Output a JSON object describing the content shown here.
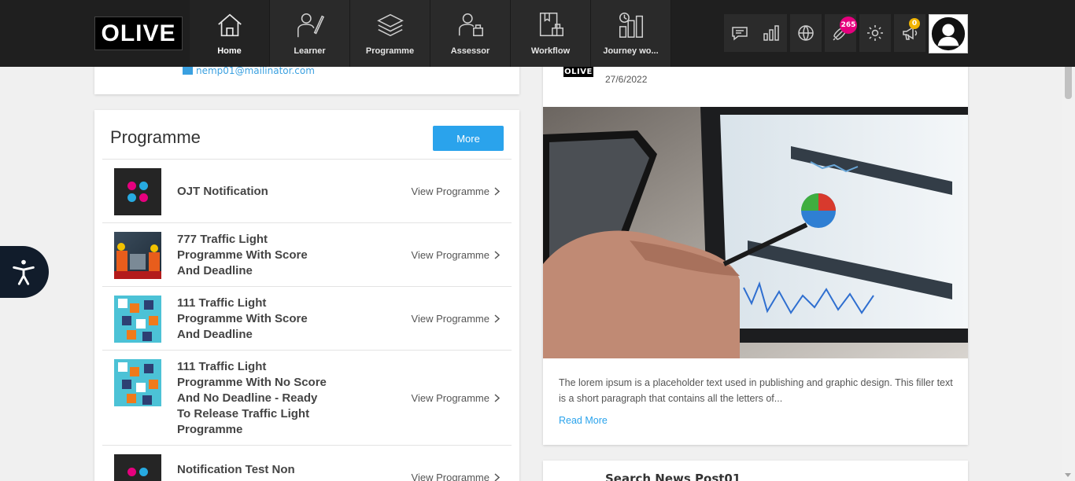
{
  "brand": {
    "logo_text": "OLIVE"
  },
  "nav": {
    "items": [
      {
        "label": "Home",
        "icon": "home-icon"
      },
      {
        "label": "Learner",
        "icon": "learner-icon"
      },
      {
        "label": "Programme",
        "icon": "programme-icon"
      },
      {
        "label": "Assessor",
        "icon": "assessor-icon"
      },
      {
        "label": "Workflow",
        "icon": "workflow-icon"
      },
      {
        "label": "Journey wo...",
        "icon": "journey-icon"
      }
    ]
  },
  "toolbar": {
    "notification_count": "265",
    "announcement_count": "0",
    "icons": [
      "chat-icon",
      "analytics-icon",
      "globe-icon",
      "notification-icon",
      "settings-icon",
      "announcement-icon",
      "avatar-icon"
    ]
  },
  "profile": {
    "email": "nemp01@mailinator.com"
  },
  "programme": {
    "title": "Programme",
    "more_label": "More",
    "view_label": "View Programme",
    "items": [
      {
        "name": "OJT Notification"
      },
      {
        "name": "777 Traffic Light Programme With Score And Deadline"
      },
      {
        "name": "111 Traffic Light Programme With Score And Deadline"
      },
      {
        "name": "111 Traffic Light Programme With No Score And No Deadline - Ready To Release Traffic Light Programme"
      },
      {
        "name": "Notification Test Non"
      }
    ]
  },
  "news": {
    "logo_text": "OLIVE",
    "date": "27/6/2022",
    "body": "The lorem ipsum is a placeholder text used in publishing and graphic design. This filler text is a short paragraph that contains all the letters of...",
    "read_more": "Read More",
    "next_title": "Search News Post01"
  },
  "colors": {
    "accent": "#2aa3ec",
    "topbar": "#1f1f1f",
    "badge_pink": "#e6007e",
    "badge_yellow": "#f0b400"
  }
}
